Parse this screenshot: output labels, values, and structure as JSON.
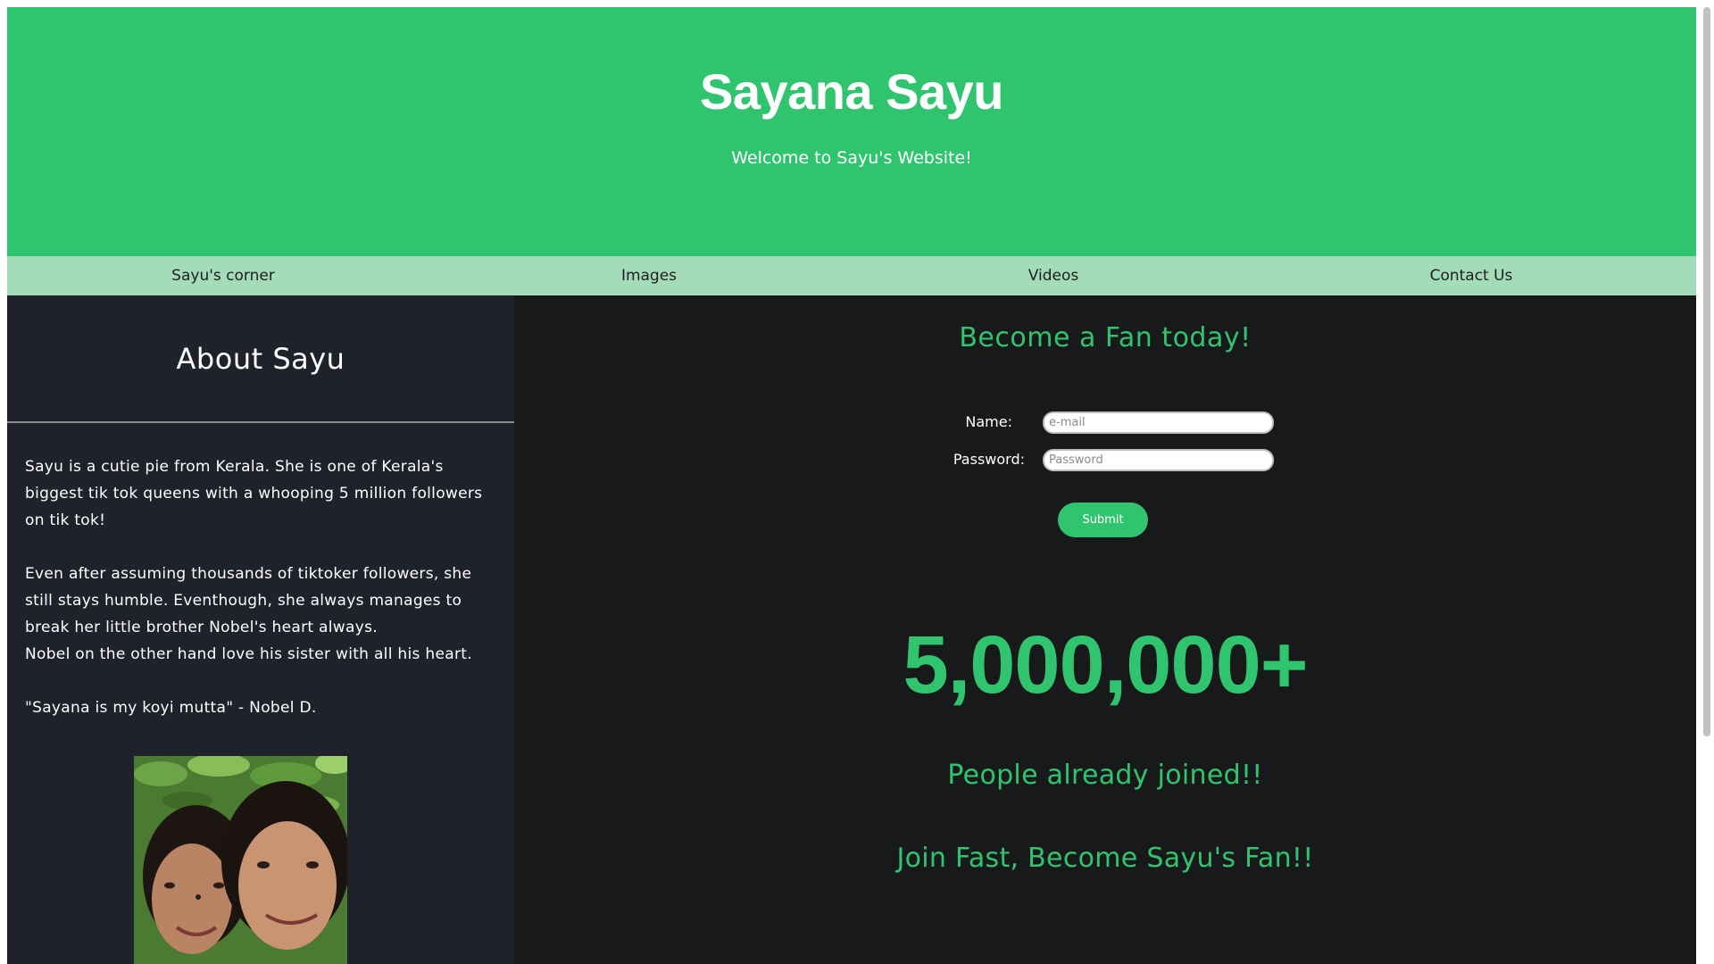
{
  "header": {
    "title": "Sayana Sayu",
    "subtitle": "Welcome to Sayu's Website!"
  },
  "nav": {
    "items": [
      {
        "label": "Sayu's corner"
      },
      {
        "label": "Images"
      },
      {
        "label": "Videos"
      },
      {
        "label": "Contact Us"
      }
    ]
  },
  "sidebar": {
    "heading": "About Sayu",
    "paragraphs": [
      "Sayu is a cutie pie from Kerala. She is one of Kerala's biggest tik tok queens with a whooping 5 million followers on tik tok!",
      "Even after assuming thousands of tiktoker followers, she still stays humble. Eventhough, she always manages to break her little brother Nobel's heart always.",
      "Nobel on the other hand love his sister with all his heart.",
      "\"Sayana is my koyi mutta\" - Nobel D."
    ]
  },
  "form": {
    "title": "Become a Fan today!",
    "name_label": "Name:",
    "name_placeholder": "e-mail",
    "password_label": "Password:",
    "password_placeholder": "Password",
    "submit_label": "Submit"
  },
  "stats": {
    "count": "5,000,000+",
    "joined_text": "People already joined!!",
    "cta_text": "Join Fast, Become Sayu's Fan!!"
  },
  "colors": {
    "brand_green": "#30c46f",
    "nav_green": "#a4dcb9",
    "sidebar_bg": "#1f222a",
    "main_bg": "#18191b"
  }
}
